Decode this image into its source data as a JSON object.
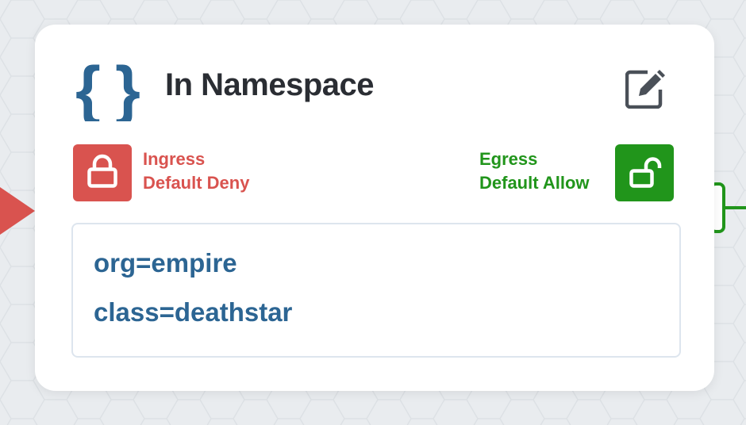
{
  "card": {
    "title": "In Namespace",
    "icon": "namespace-braces-icon",
    "edit_icon": "edit-icon"
  },
  "ingress": {
    "line1": "Ingress",
    "line2": "Default Deny",
    "icon": "lock-closed-icon",
    "color": "#d9534f"
  },
  "egress": {
    "line1": "Egress",
    "line2": "Default Allow",
    "icon": "lock-open-icon",
    "color": "#21951b"
  },
  "labels": [
    "org=empire",
    "class=deathstar"
  ],
  "colors": {
    "braces": "#2c6593",
    "label_text": "#2c6593",
    "title": "#2a2d33",
    "background": "#e9ecef"
  }
}
